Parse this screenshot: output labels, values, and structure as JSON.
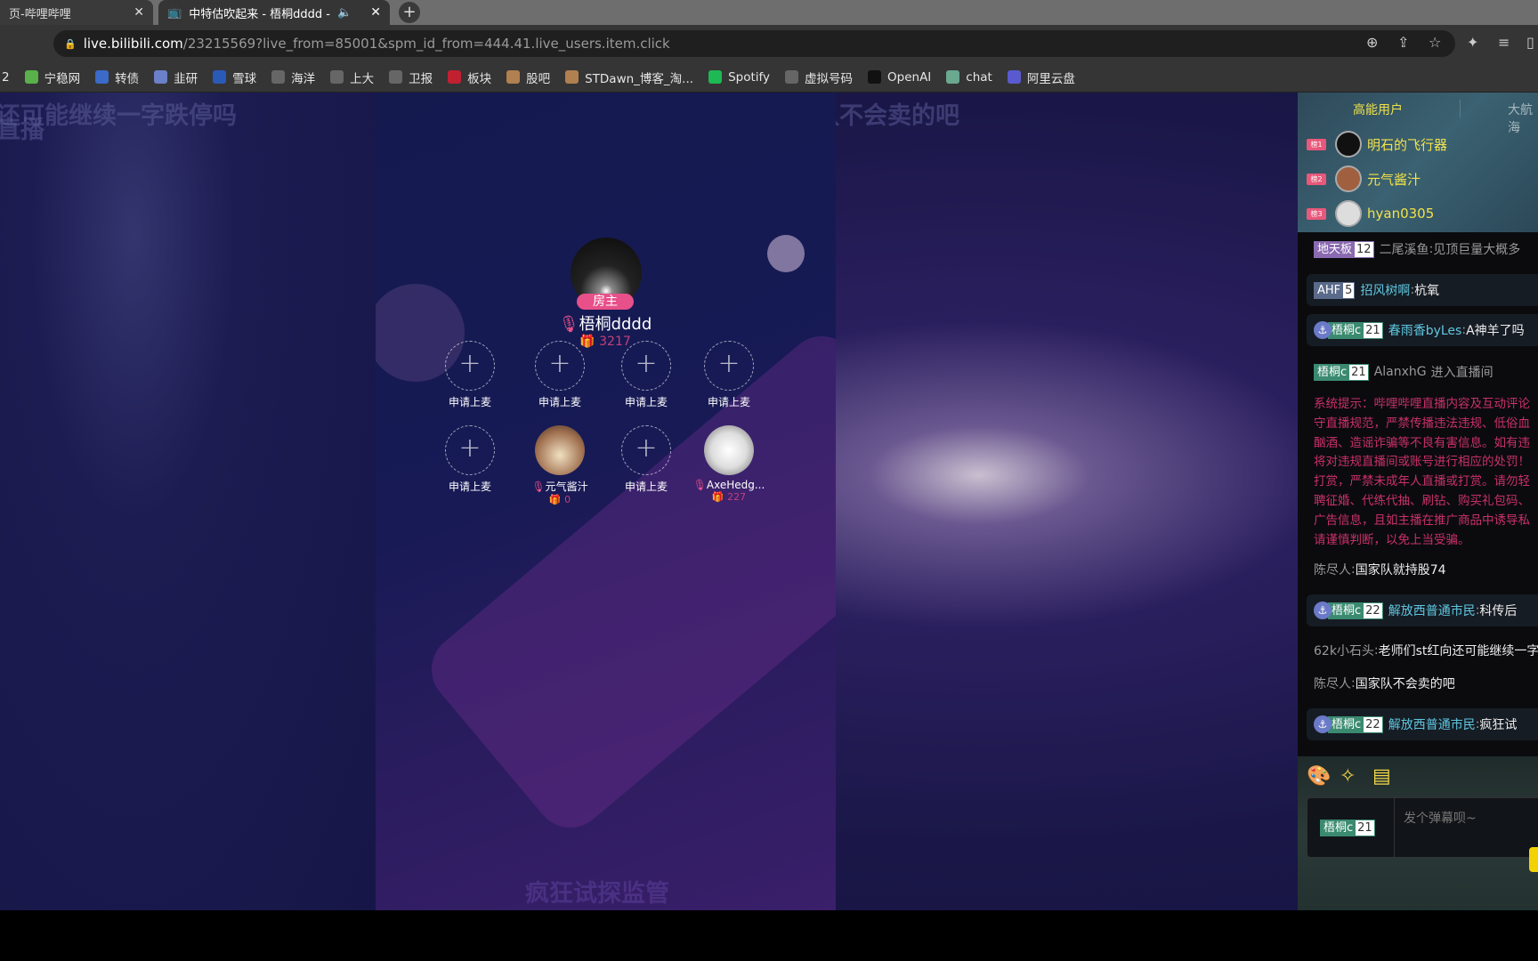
{
  "browser": {
    "tabs": [
      {
        "title": "页-哔哩哔哩",
        "close": "✕"
      },
      {
        "title": "中特估吹起来 - 梧桐dddd -",
        "audio": "🔈",
        "close": "✕"
      }
    ],
    "new_tab": "+",
    "url_host": "live.bilibili.com",
    "url_path": "/23215569?live_from=85001&spm_id_from=444.41.live_users.item.click",
    "bookmarks_prefix": "2",
    "bookmarks": [
      {
        "label": "宁稳网",
        "color": "#5ab04a"
      },
      {
        "label": "转债",
        "color": "#3b6ac8"
      },
      {
        "label": "韭研",
        "color": "#6a80c8"
      },
      {
        "label": "雪球",
        "color": "#2a5ab8"
      },
      {
        "label": "海洋",
        "color": "#666"
      },
      {
        "label": "上大",
        "color": "#666"
      },
      {
        "label": "卫报",
        "color": "#666"
      },
      {
        "label": "板块",
        "color": "#c02030"
      },
      {
        "label": "股吧",
        "color": "#b08050"
      },
      {
        "label": "STDawn_博客_淘...",
        "color": "#b08050"
      },
      {
        "label": "Spotify",
        "color": "#1db954"
      },
      {
        "label": "虚拟号码",
        "color": "#666"
      },
      {
        "label": "OpenAI",
        "color": "#111"
      },
      {
        "label": "chat",
        "color": "#6aa890"
      },
      {
        "label": "阿里云盘",
        "color": "#5a5ad0"
      }
    ]
  },
  "stage": {
    "ghost_danmaku": [
      "还可能继续一字跌停吗",
      "直播",
      "国家队不会卖的吧",
      "疯狂试探监管"
    ],
    "host": {
      "badge": "房主",
      "name": "梧桐dddd",
      "gift": "3217"
    },
    "seats": [
      {
        "label": "申请上麦"
      },
      {
        "label": "申请上麦"
      },
      {
        "label": "申请上麦"
      },
      {
        "label": "申请上麦"
      },
      {
        "label": "申请上麦"
      },
      {
        "label": "元气酱汁",
        "gift": "0"
      },
      {
        "label": "申请上麦"
      },
      {
        "label": "AxeHedg...",
        "gift": "227"
      }
    ]
  },
  "sidebar": {
    "tabs": [
      "高能用户",
      "大航海"
    ],
    "top_users": [
      {
        "rank": "榜1",
        "name": "明石的飞行器"
      },
      {
        "rank": "榜2",
        "name": "元气酱汁"
      },
      {
        "rank": "榜3",
        "name": "hyan0305"
      }
    ],
    "messages": [
      {
        "medal": "地天板",
        "level": "12",
        "user": "二尾溪鱼",
        "text": "见顶巨量大概多"
      },
      {
        "medal": "AHF",
        "level": "5",
        "user": "招风树啊",
        "text": "杭氧"
      },
      {
        "medal": "梧桐c",
        "level": "21",
        "user": "春雨香byLes",
        "text": "A神羊了吗"
      },
      {
        "medal": "梧桐c",
        "level": "21",
        "user": "AlanxhG",
        "text": "进入直播间"
      },
      {
        "user": "陈尽人",
        "text": "国家队就持股74"
      },
      {
        "medal": "梧桐c",
        "level": "22",
        "user": "解放西普通市民",
        "text": "科传后"
      },
      {
        "user": "62k小石头",
        "text": "老师们st红向还可能继续一字"
      },
      {
        "user": "陈尽人",
        "text": "国家队不会卖的吧"
      },
      {
        "medal": "梧桐c",
        "level": "22",
        "user": "解放西普通市民",
        "text": "疯狂试"
      }
    ],
    "system_notice": [
      "系统提示：哔哩哔哩直播内容及互动评论",
      "守直播规范，严禁传播违法违规、低俗血",
      "酗酒、造谣诈骗等不良有害信息。如有违",
      "将对违规直播间或账号进行相应的处罚！",
      "打赏，严禁未成年人直播或打赏。请勿轻",
      "聘征婚、代练代抽、刷钻、购买礼包码、",
      "广告信息，且如主播在推广商品中诱导私",
      "请谨慎判断，以免上当受骗。"
    ],
    "input": {
      "medal": "梧桐c",
      "level": "21",
      "placeholder": "发个弹幕呗~"
    }
  }
}
